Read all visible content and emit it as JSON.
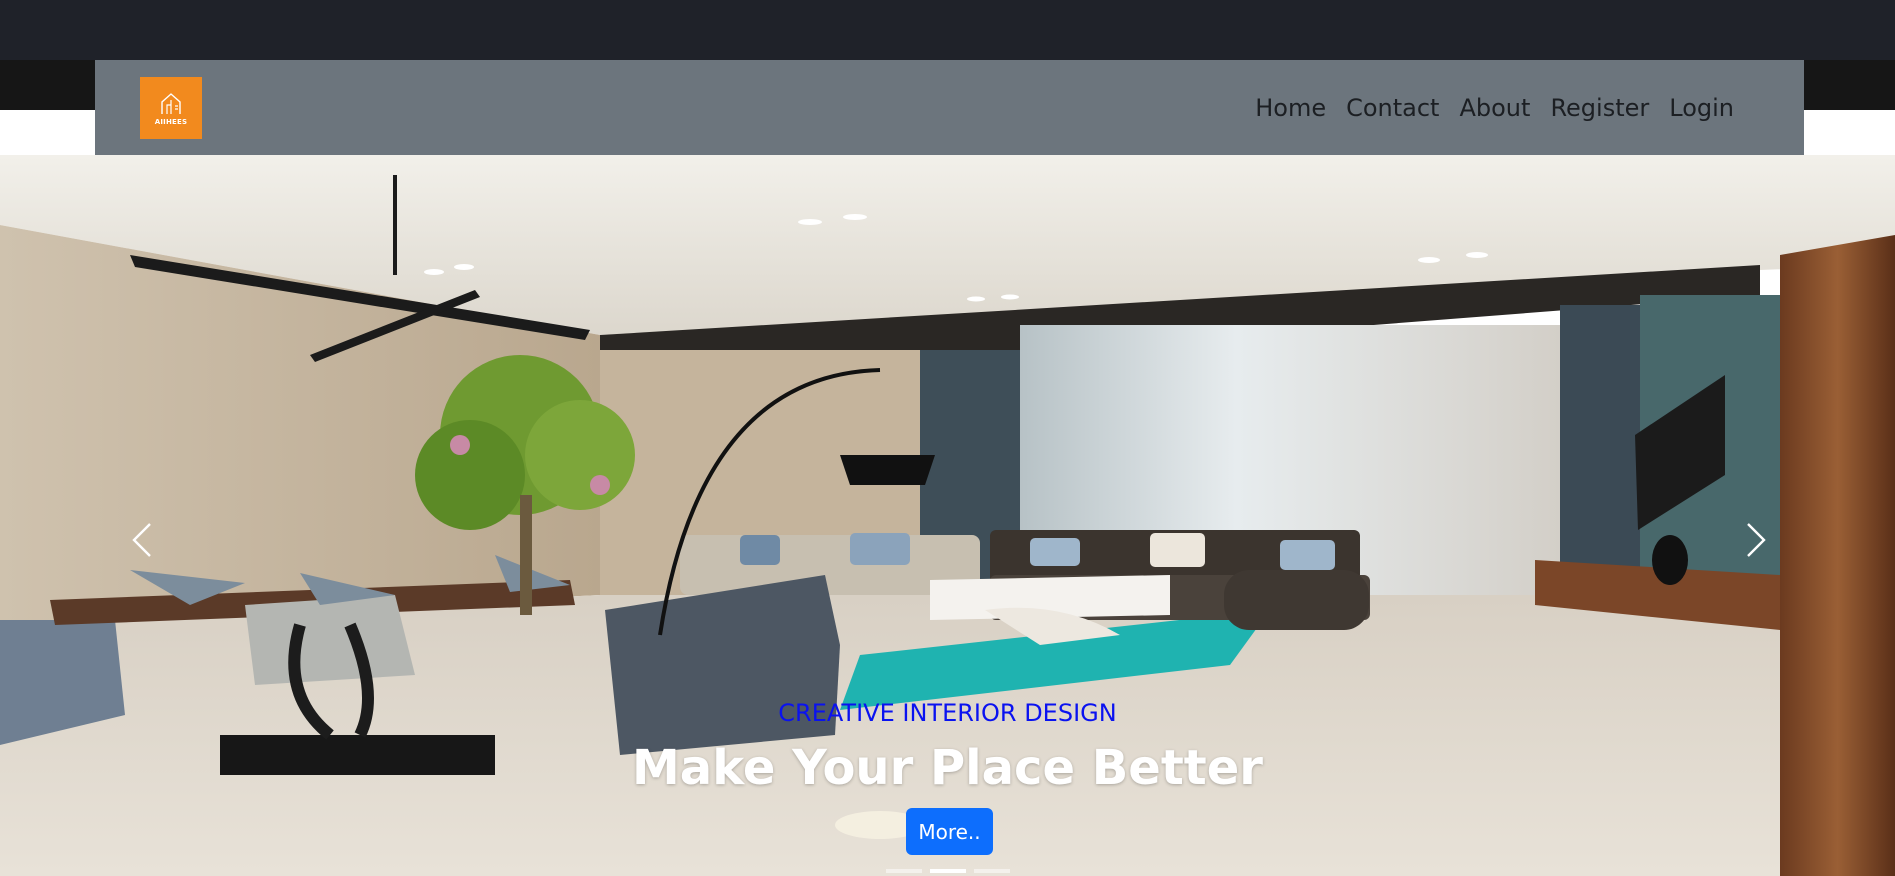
{
  "brand": {
    "logo_text": "AIIHEES",
    "logo_color": "#f28a1e"
  },
  "nav": {
    "links": [
      {
        "label": "Home"
      },
      {
        "label": "Contact"
      },
      {
        "label": "About"
      },
      {
        "label": "Register"
      },
      {
        "label": "Login"
      }
    ]
  },
  "hero": {
    "subtitle": "CREATIVE INTERIOR DESIGN",
    "title": "Make Your Place Better",
    "button_label": "More..",
    "prev_icon": "chevron-left-icon",
    "next_icon": "chevron-right-icon",
    "slide_count": 3,
    "active_slide": 2
  },
  "colors": {
    "topbar": "#1f2229",
    "navbar": "#6c757d",
    "subtitle": "#0a12f0",
    "button": "#0d6efd"
  }
}
